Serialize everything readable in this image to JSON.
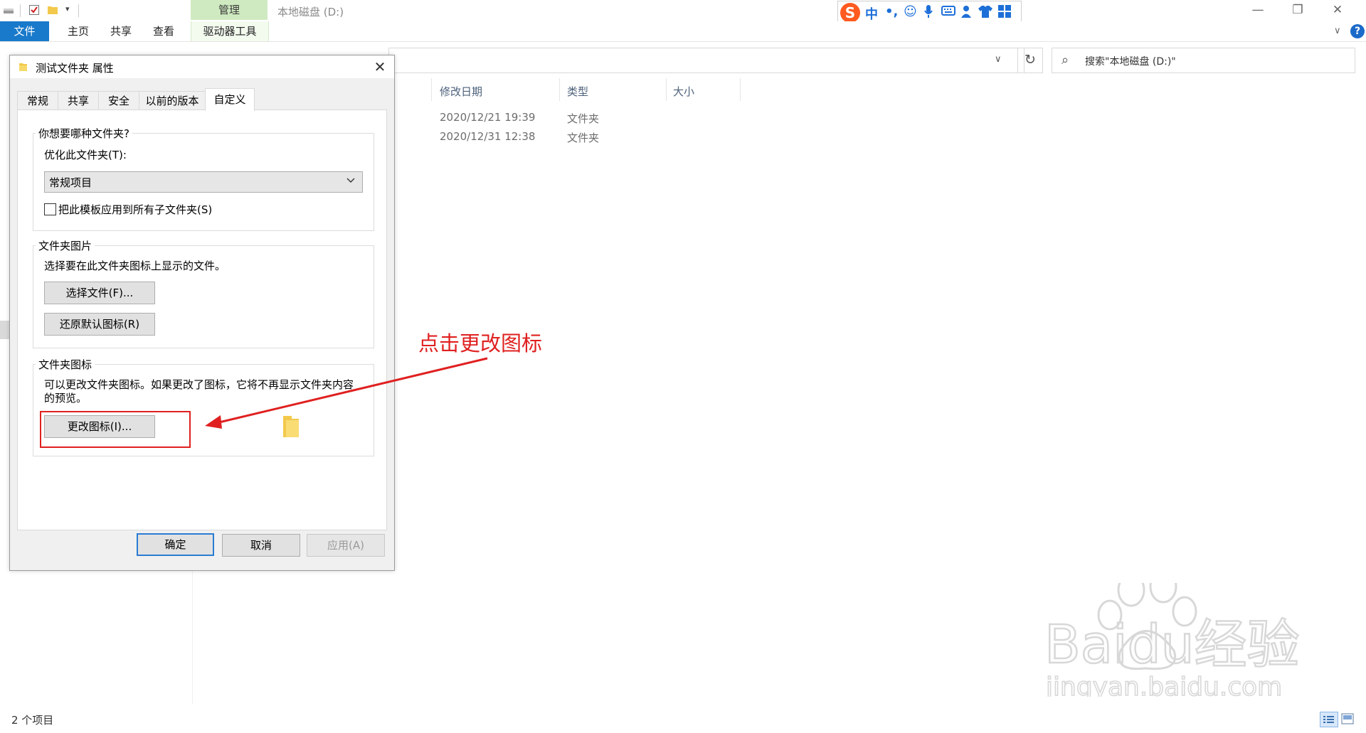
{
  "window": {
    "title": "本地磁盘 (D:)",
    "manage_tab": "管理",
    "minimize": "—",
    "restore": "❐",
    "close": "✕"
  },
  "ribbon": {
    "tabs": [
      "文件",
      "主页",
      "共享",
      "查看",
      "驱动器工具"
    ],
    "help": "?",
    "collapse": "∨"
  },
  "ime": {
    "items": [
      "S",
      "中",
      "•,",
      "☺",
      "🎤",
      "⌨",
      "👤",
      "👕",
      "▦"
    ]
  },
  "address": {
    "chevron": "∨",
    "refresh": "↻",
    "search_placeholder": "搜索\"本地磁盘 (D:)\"",
    "search_icon": "⌕"
  },
  "file_list": {
    "columns": [
      "修改日期",
      "类型",
      "大小"
    ],
    "rows": [
      {
        "date": "2020/12/21 19:39",
        "type": "文件夹",
        "size": ""
      },
      {
        "date": "2020/12/31 12:38",
        "type": "文件夹",
        "size": ""
      }
    ]
  },
  "status": {
    "count": "2 个项目"
  },
  "dialog": {
    "title": "测试文件夹 属性",
    "close": "✕",
    "tabs": [
      "常规",
      "共享",
      "安全",
      "以前的版本",
      "自定义"
    ],
    "active_tab": "自定义",
    "group1": {
      "label": "你想要哪种文件夹?",
      "optimize_label": "优化此文件夹(T):",
      "combo_value": "常规项目",
      "checkbox_label": "把此模板应用到所有子文件夹(S)",
      "checkbox_checked": false
    },
    "group2": {
      "label": "文件夹图片",
      "desc": "选择要在此文件夹图标上显示的文件。",
      "choose_button": "选择文件(F)...",
      "restore_button": "还原默认图标(R)"
    },
    "group3": {
      "label": "文件夹图标",
      "desc_line1": "可以更改文件夹图标。如果更改了图标，它将不再显示文件夹内容",
      "desc_line2": "的预览。",
      "change_button": "更改图标(I)..."
    },
    "ok_button": "确定",
    "cancel_button": "取消",
    "apply_button": "应用(A)"
  },
  "annotation": {
    "text": "点击更改图标",
    "color": "#e02020"
  },
  "watermark": {
    "brand": "Baidu经验",
    "url": "jingyan.baidu.com"
  },
  "colors": {
    "file_tab": "#1979ca",
    "manage_tab": "#cfeac0",
    "default_button_border": "#2b7cd3",
    "help": "#1b6ac9"
  }
}
